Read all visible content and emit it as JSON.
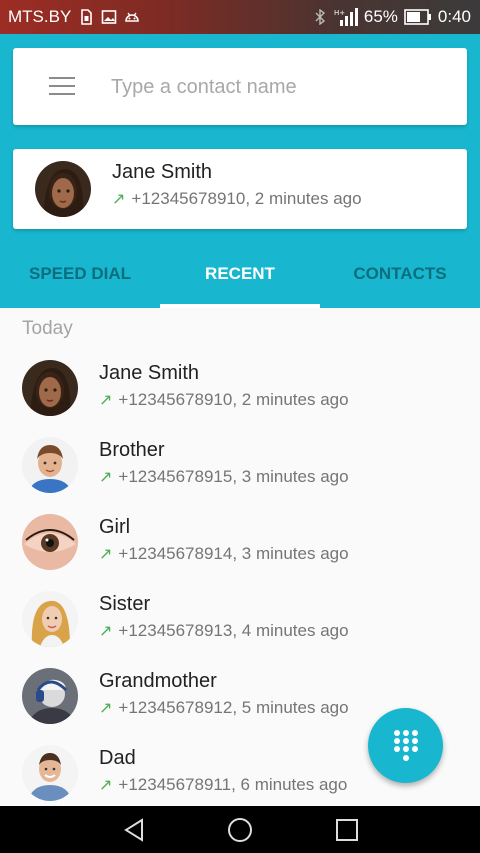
{
  "status_bar": {
    "carrier": "MTS.BY",
    "battery": "65%",
    "time": "0:40"
  },
  "search": {
    "placeholder": "Type a contact name"
  },
  "last_call": {
    "name": "Jane Smith",
    "detail": "+12345678910, 2 minutes ago"
  },
  "tabs": [
    {
      "label": "SPEED DIAL",
      "active": false
    },
    {
      "label": "RECENT",
      "active": true
    },
    {
      "label": "CONTACTS",
      "active": false
    }
  ],
  "list": {
    "section": "Today",
    "rows": [
      {
        "name": "Jane Smith",
        "detail": "+12345678910, 2 minutes ago"
      },
      {
        "name": "Brother",
        "detail": "+12345678915, 3 minutes ago"
      },
      {
        "name": "Girl",
        "detail": "+12345678914, 3 minutes ago"
      },
      {
        "name": "Sister",
        "detail": "+12345678913, 4 minutes ago"
      },
      {
        "name": "Grandmother",
        "detail": "+12345678912, 5 minutes ago"
      },
      {
        "name": "Dad",
        "detail": "+12345678911, 6 minutes ago"
      }
    ]
  },
  "colors": {
    "accent": "#18b7cf",
    "outgoing_arrow": "#4caf50"
  }
}
